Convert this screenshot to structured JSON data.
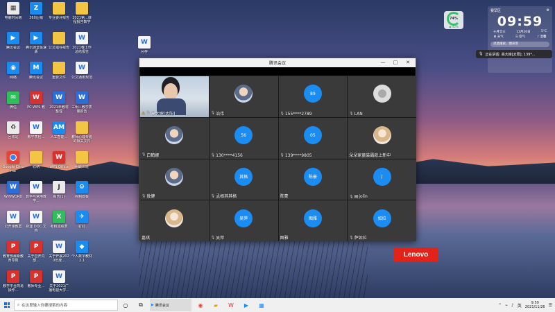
{
  "desktop_icons": [
    {
      "label": "电脑时间跑",
      "glyph": "▦",
      "cls": "g-white"
    },
    {
      "label": "360压缩",
      "glyph": "Z",
      "cls": "g-blue"
    },
    {
      "label": "专业委评报告",
      "glyph": "",
      "cls": "g-folder"
    },
    {
      "label": "2021第...课程报告数学范...",
      "glyph": "",
      "cls": "g-folder"
    },
    {
      "label": "腾讯会议",
      "glyph": "▶",
      "cls": "g-blue"
    },
    {
      "label": "腾讯课堂极速版",
      "glyph": "▶",
      "cls": "g-blue"
    },
    {
      "label": "公文指导报告",
      "glyph": "",
      "cls": "g-folder"
    },
    {
      "label": "2021春工作总结报告",
      "glyph": "W",
      "cls": "g-doc"
    },
    {
      "label": "网络",
      "glyph": "◉",
      "cls": "g-blue"
    },
    {
      "label": "腾讯会议",
      "glyph": "M",
      "cls": "g-blue"
    },
    {
      "label": "重要文件",
      "glyph": "",
      "cls": "g-folder"
    },
    {
      "label": "公文通用规范",
      "glyph": "W",
      "cls": "g-doc"
    },
    {
      "label": "微信",
      "glyph": "✉",
      "cls": "g-green"
    },
    {
      "label": "PC WPS 教",
      "glyph": "W",
      "cls": "g-red"
    },
    {
      "label": "2021年教材整理",
      "glyph": "W",
      "cls": "g-word"
    },
    {
      "label": "三明...教学质量报告",
      "glyph": "W",
      "cls": "g-word"
    },
    {
      "label": "回收站",
      "glyph": "♻",
      "cls": "g-white"
    },
    {
      "label": "教学质检...",
      "glyph": "W",
      "cls": "g-doc"
    },
    {
      "label": "人工智能...",
      "glyph": "AM",
      "cls": "g-blue"
    },
    {
      "label": "教师心理专题的相关文件",
      "glyph": "",
      "cls": "g-folder"
    },
    {
      "label": "Google Chrome",
      "glyph": "",
      "cls": "g-chrome"
    },
    {
      "label": "收纳",
      "glyph": "",
      "cls": "g-folder"
    },
    {
      "label": "WPS Office",
      "glyph": "W",
      "cls": "g-red"
    },
    {
      "label": "组联三班",
      "glyph": "",
      "cls": "g-folder"
    },
    {
      "label": "WINWORD",
      "glyph": "W",
      "cls": "g-word"
    },
    {
      "label": "数学与常用教学...",
      "glyph": "W",
      "cls": "g-doc"
    },
    {
      "label": "报告(1)",
      "glyph": "J",
      "cls": "g-white"
    },
    {
      "label": "控制面板",
      "glyph": "⚙",
      "cls": "g-blue"
    },
    {
      "label": "公开课教案",
      "glyph": "W",
      "cls": "g-doc"
    },
    {
      "label": "新建 DOC 文档",
      "glyph": "W",
      "cls": "g-doc"
    },
    {
      "label": "考核成绩表",
      "glyph": "X",
      "cls": "g-green"
    },
    {
      "label": "钉钉",
      "glyph": "✈",
      "cls": "g-blue"
    },
    {
      "label": "教育部最新教育导则",
      "glyph": "P",
      "cls": "g-red"
    },
    {
      "label": "关于召开内部...",
      "glyph": "P",
      "cls": "g-red"
    },
    {
      "label": "关于开展2020年度...",
      "glyph": "W",
      "cls": "g-doc"
    },
    {
      "label": "个人数字教材2.1",
      "glyph": "◆",
      "cls": "g-blue"
    },
    {
      "label": "教学平台简易操作...",
      "glyph": "P",
      "cls": "g-red"
    },
    {
      "label": "教师专业...",
      "glyph": "P",
      "cls": "g-red"
    },
    {
      "label": "关于2021广播电视大学...",
      "glyph": "W",
      "cls": "g-doc"
    }
  ],
  "pinned_icon": {
    "label": "另存",
    "glyph": "W",
    "cls": "g-doc"
  },
  "window": {
    "title": "腾讯会议",
    "controls": {
      "min": "—",
      "max": "□",
      "close": "✕"
    }
  },
  "participants": [
    {
      "name": "高大婶[太阳]",
      "type": "video",
      "active": true,
      "warn": true
    },
    {
      "name": "治伟",
      "type": "photo",
      "avatar_text": ""
    },
    {
      "name": "155****2789",
      "type": "blue",
      "avatar_text": "89"
    },
    {
      "name": "LAN",
      "type": "person",
      "avatar_text": ""
    },
    {
      "name": "白鹤娜",
      "type": "photo",
      "avatar_text": ""
    },
    {
      "name": "130****4156",
      "type": "blue",
      "avatar_text": "56"
    },
    {
      "name": "139****9805",
      "type": "blue",
      "avatar_text": "05"
    },
    {
      "name": "朵朵家童装霸款上新中",
      "type": "photo2",
      "avatar_text": "",
      "no_mic": true
    },
    {
      "name": "敖健",
      "type": "photo",
      "avatar_text": ""
    },
    {
      "name": "孟根其其格",
      "type": "blue",
      "avatar_text": "其格"
    },
    {
      "name": "陈豪",
      "type": "blue",
      "avatar_text": "陈豪",
      "no_mic": true
    },
    {
      "name": "jolin",
      "type": "blue",
      "avatar_text": "J",
      "badge": "▤"
    },
    {
      "name": "嘉琪",
      "type": "photo2",
      "avatar_text": "",
      "no_mic": true
    },
    {
      "name": "吴萍",
      "type": "blue",
      "avatar_text": "吴萍"
    },
    {
      "name": "图雅",
      "type": "blue",
      "avatar_text": "图雅",
      "no_mic": true
    },
    {
      "name": "萨如拉",
      "type": "blue",
      "avatar_text": "如拉"
    }
  ],
  "perf_widget": {
    "percent": "74%",
    "sub": "◉ 42%"
  },
  "clock_widget": {
    "location": "赛罕区",
    "time": "09:59",
    "lunar": "十月廿三",
    "date": "11月26日",
    "temp": "5°C",
    "items": [
      "⊞ 天气",
      "☰ 空气",
      "♪ 温馨"
    ],
    "search": "点此搜索，图讯等"
  },
  "toast": {
    "text": "正在讲话: 高大婶[太阳]; 139*..."
  },
  "brand": {
    "text": "Lenovo"
  },
  "taskbar": {
    "search_placeholder": "在这里输入你要搜索的内容",
    "task_app": "腾讯会议",
    "time": "9:59",
    "date": "2021/11/26",
    "lang": "英"
  }
}
